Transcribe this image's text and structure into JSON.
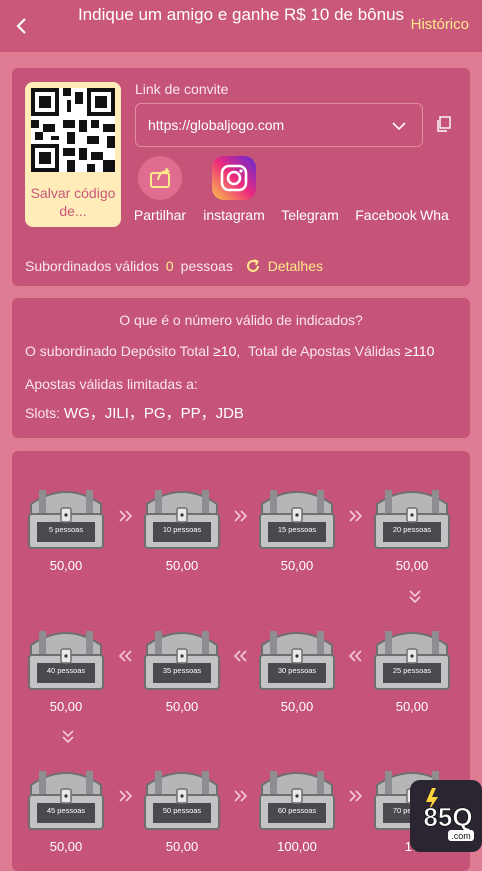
{
  "header": {
    "title": "Indique um amigo e ganhe R$ 10 de bônus",
    "history": "Histórico"
  },
  "invite": {
    "qr_caption": "Salvar código de...",
    "link_label": "Link de convite",
    "link_value": "https://globaljogo.com",
    "share": [
      {
        "label": "Partilhar",
        "icon": "share-icon"
      },
      {
        "label": "instagram",
        "icon": "instagram-icon"
      },
      {
        "label": "Telegram",
        "icon": "telegram-icon"
      },
      {
        "label": "Facebook",
        "icon": "facebook-icon"
      },
      {
        "label": "Wha",
        "icon": "whatsapp-icon"
      }
    ],
    "subordinates_label": "Subordinados válidos",
    "subordinates_count": "0",
    "subordinates_unit": "pessoas",
    "details": "Detalhes"
  },
  "rules": {
    "question": "O que é o número válido de indicados?",
    "line1_prefix": "O subordinado Depósito Total",
    "line1_v1": "≥10",
    "line1_mid": "Total de Apostas Válidas",
    "line1_v2": "≥110",
    "line2": "Apostas válidas limitadas a:",
    "slots_label": "Slots:",
    "slots": "WG，JILI，PG，PP，JDB"
  },
  "rewards": [
    {
      "label": "5 pessoas",
      "amount": "50,00"
    },
    {
      "label": "10 pessoas",
      "amount": "50,00"
    },
    {
      "label": "15 pessoas",
      "amount": "50,00"
    },
    {
      "label": "20 pessoas",
      "amount": "50,00"
    },
    {
      "label": "25 pessoas",
      "amount": "50,00"
    },
    {
      "label": "30 pessoas",
      "amount": "50,00"
    },
    {
      "label": "35 pessoas",
      "amount": "50,00"
    },
    {
      "label": "40 pessoas",
      "amount": "50,00"
    },
    {
      "label": "45 pessoas",
      "amount": "50,00"
    },
    {
      "label": "50 pessoas",
      "amount": "50,00"
    },
    {
      "label": "60 pessoas",
      "amount": "100,00"
    },
    {
      "label": "70 pessoas",
      "amount": "10"
    }
  ],
  "badge": {
    "text": "85Q",
    "sub": ".com"
  },
  "colors": {
    "header": "#c9587a",
    "background": "#e07b94",
    "card": "#c55478",
    "accent": "#ffe98a"
  }
}
